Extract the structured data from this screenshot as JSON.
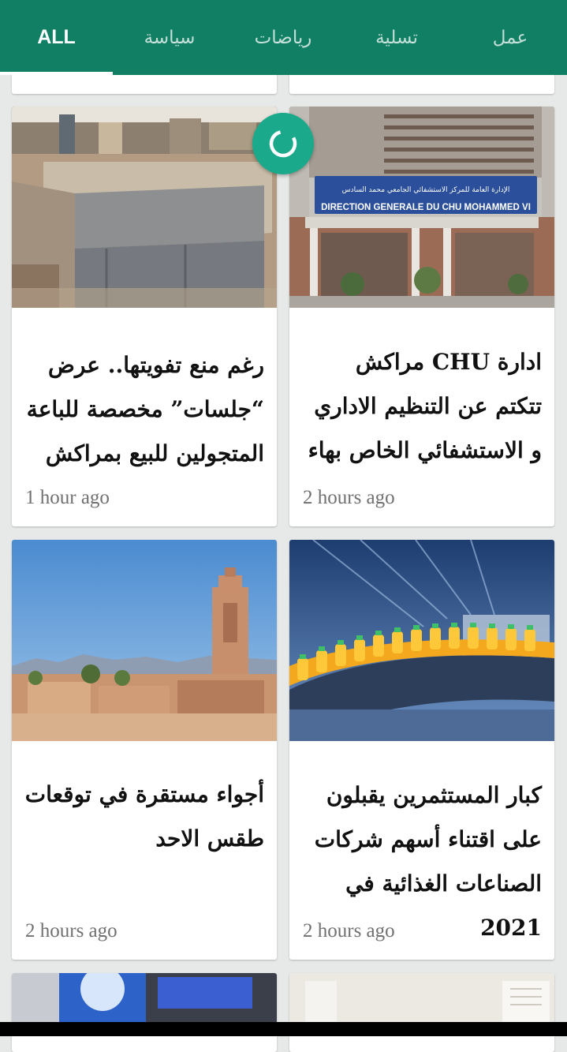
{
  "tabs": [
    {
      "label": "ALL"
    },
    {
      "label": "سياسة"
    },
    {
      "label": "رياضات"
    },
    {
      "label": "تسلية"
    },
    {
      "label": "عمل"
    }
  ],
  "articles": [
    {
      "title": "رغم منع تفويتها.. عرض “جلسات” مخصصة للباعة المتجولين للبيع بمراكش",
      "time": "1 hour ago",
      "image": "market-stall-photo"
    },
    {
      "title": "ادارة CHU مراكش تتكتم عن التنظيم الاداري و الاستشفائي الخاص بهاء",
      "time": "2 hours ago",
      "image": "chu-building-photo",
      "sign_line1": "الإدارة العامة للمركز الاستشفائي الجامعي محمد السادس",
      "sign_line2": "DIRECTION GENERALE DU CHU MOHAMMED VI"
    },
    {
      "title": "أجواء مستقرة في توقعات طقس الاحد",
      "time": "2 hours ago",
      "image": "marrakech-minaret-photo"
    },
    {
      "title": "كبار المستثمرين يقبلون على اقتناء أسهم شركات الصناعات الغذائية في 2021",
      "time": "2 hours ago",
      "image": "juice-factory-photo"
    }
  ],
  "colors": {
    "primary": "#107f64",
    "accent": "#1aa98a"
  }
}
